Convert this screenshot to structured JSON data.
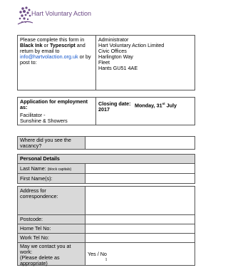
{
  "logo": {
    "text": "Hart Voluntary Action"
  },
  "contact": {
    "instr_1": "Please complete this form in",
    "instr_bold_1": "Black Ink",
    "instr_or": " or ",
    "instr_bold_2": "Typescript",
    "instr_and": " and",
    "instr_2": "return by email to",
    "email": "info@hartvolaction.org.uk",
    "instr_orby": " or by",
    "instr_3": "post to:",
    "address": [
      "Administrator",
      "Hart Voluntary Action Limited",
      "Civic Offices",
      "Harlington Way",
      "Fleet",
      "Hants  GU51 4AE"
    ]
  },
  "application": {
    "heading": "Application for employment as:",
    "role_line1": "Facilitator -",
    "role_line2": "Sunshine & Showers",
    "closing_label": "Closing date:",
    "closing_day": "Monday, 31",
    "closing_sup": "st",
    "closing_month": " July",
    "closing_year": "2017"
  },
  "vacancy": {
    "question_line1": "Where did you see the",
    "question_line2": "vacancy?"
  },
  "personal": {
    "heading": "Personal Details",
    "last_name": "Last Name:",
    "last_name_hint": "(block capitals)",
    "first_names": "First Name(s):"
  },
  "address_section": {
    "address_label_1": "Address for",
    "address_label_2": "correspondence:",
    "postcode": "Postcode:",
    "home_tel": "Home Tel No:",
    "work_tel": "Work Tel No:",
    "contact_work_1": "May we contact you at",
    "contact_work_2": "work:",
    "contact_work_3": "(Please delete as",
    "contact_work_4": "appropriate)",
    "yes_no": "Yes / No"
  },
  "footer": {
    "page_number": "1"
  }
}
